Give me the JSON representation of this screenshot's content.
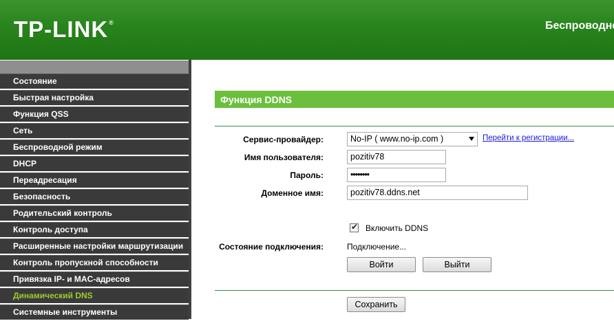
{
  "header": {
    "logo_text": "TP-LINK",
    "logo_mark": "®",
    "title": "Беспроводно"
  },
  "sidebar": {
    "items": [
      {
        "label": "Состояние"
      },
      {
        "label": "Быстрая настройка"
      },
      {
        "label": "Функция QSS"
      },
      {
        "label": "Сеть"
      },
      {
        "label": "Беспроводной режим"
      },
      {
        "label": "DHCP"
      },
      {
        "label": "Переадресация"
      },
      {
        "label": "Безопасность"
      },
      {
        "label": "Родительский контроль"
      },
      {
        "label": "Контроль доступа"
      },
      {
        "label": "Расширенные настройки маршрутизации"
      },
      {
        "label": "Контроль пропускной способности"
      },
      {
        "label": "Привязка IP- и MAC-адресов"
      },
      {
        "label": "Динамический DNS",
        "active": true
      },
      {
        "label": "Системные инструменты"
      }
    ]
  },
  "main": {
    "section_title": "Функция DDNS",
    "provider": {
      "label": "Сервис-провайдер:",
      "value": "No-IP ( www.no-ip.com )",
      "register_link": "Перейти к регистрации..."
    },
    "username": {
      "label": "Имя пользователя:",
      "value": "pozitiv78"
    },
    "password": {
      "label": "Пароль:",
      "value": "••••••••"
    },
    "domain": {
      "label": "Доменное имя:",
      "value": "pozitiv78.ddns.net"
    },
    "enable_ddns": {
      "label": "Включить DDNS",
      "checked": true
    },
    "status": {
      "label": "Состояние подключения:",
      "value": "Подключение..."
    },
    "login_button": "Войти",
    "logout_button": "Выйти",
    "save_button": "Сохранить"
  },
  "colors": {
    "header_green": "#258019",
    "section_green": "#6cbf3c",
    "sidebar_bg": "#3a3a3a",
    "active_menu": "#9acd2c",
    "link_blue": "#1a1ad2"
  }
}
